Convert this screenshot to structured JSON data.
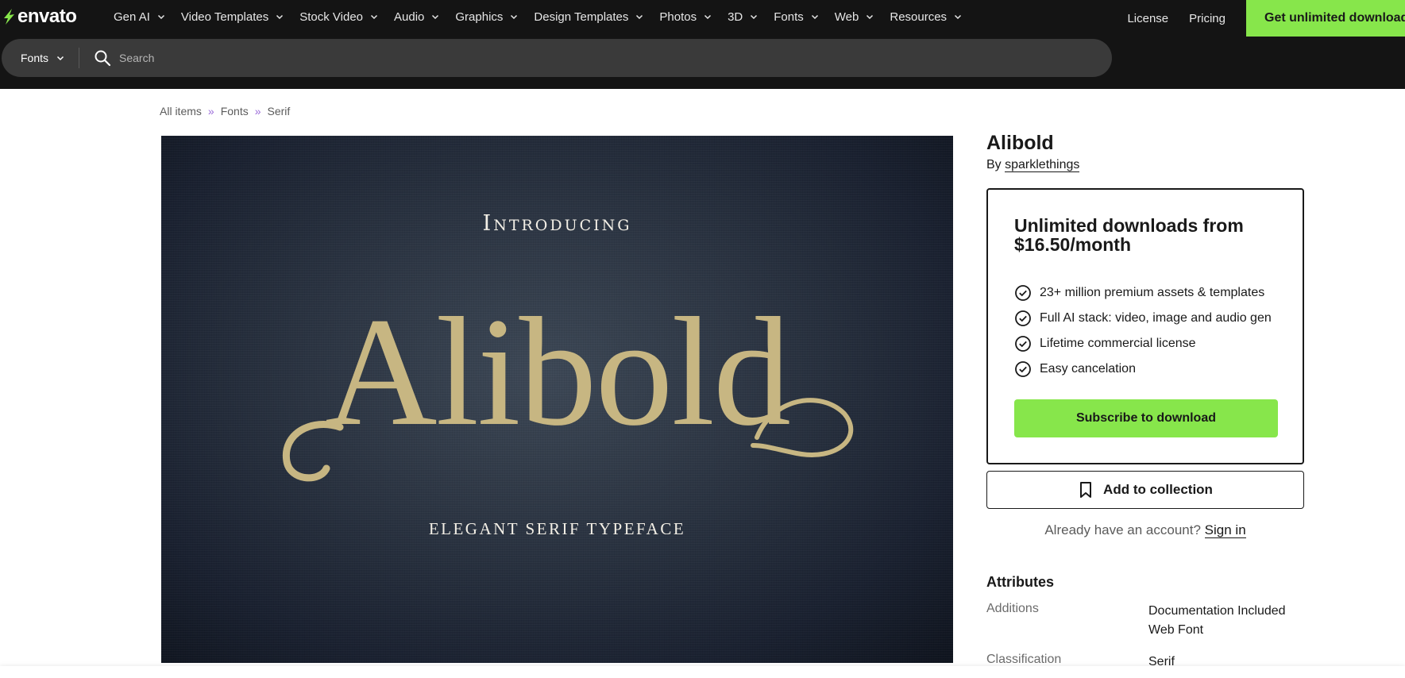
{
  "header": {
    "logo_text": "envato",
    "nav": [
      {
        "label": "Gen AI"
      },
      {
        "label": "Video Templates"
      },
      {
        "label": "Stock Video"
      },
      {
        "label": "Audio"
      },
      {
        "label": "Graphics"
      },
      {
        "label": "Design Templates"
      },
      {
        "label": "Photos"
      },
      {
        "label": "3D"
      },
      {
        "label": "Fonts"
      },
      {
        "label": "Web"
      },
      {
        "label": "Resources"
      }
    ],
    "license_label": "License",
    "pricing_label": "Pricing",
    "cta_label": "Get unlimited downloads",
    "accent_color": "#87e64b"
  },
  "search": {
    "category": "Fonts",
    "placeholder": "Search"
  },
  "breadcrumb": [
    "All items",
    "Fonts",
    "Serif"
  ],
  "preview": {
    "intro": "Introducing",
    "name": "Alibold",
    "tagline": "ELEGANT SERIF TYPEFACE"
  },
  "item": {
    "title": "Alibold",
    "by_prefix": "By",
    "author": "sparklethings"
  },
  "subscription": {
    "heading": "Unlimited downloads from $16.50/month",
    "benefits": [
      "23+ million premium assets & templates",
      "Full AI stack: video, image and audio gen",
      "Lifetime commercial license",
      "Easy cancelation"
    ],
    "subscribe_label": "Subscribe to download"
  },
  "collection_label": "Add to collection",
  "signin": {
    "prompt": "Already have an account?",
    "link": "Sign in"
  },
  "attributes": {
    "heading": "Attributes",
    "rows": [
      {
        "key": "Additions",
        "values": [
          "Documentation Included",
          "Web Font"
        ]
      },
      {
        "key": "Classification",
        "values": [
          "Serif"
        ]
      }
    ]
  }
}
